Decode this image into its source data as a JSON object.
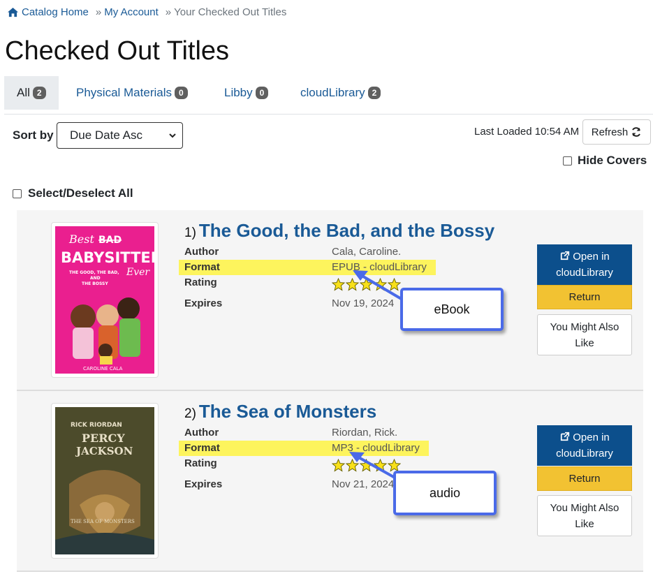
{
  "breadcrumb": {
    "home": "Catalog Home",
    "sep1": "»",
    "account": "My Account",
    "sep2": "»",
    "current": "Your Checked Out Titles"
  },
  "page_title": "Checked Out Titles",
  "tabs": [
    {
      "label": "All",
      "count": "2"
    },
    {
      "label": "Physical Materials",
      "count": "0"
    },
    {
      "label": "Libby",
      "count": "0"
    },
    {
      "label": "cloudLibrary",
      "count": "2"
    }
  ],
  "toolbar": {
    "sort_label": "Sort by",
    "sort_value": "Due Date Asc",
    "last_loaded": "Last Loaded 10:54 AM",
    "refresh_label": "Refresh",
    "hide_covers_label": "Hide Covers",
    "select_all_label": "Select/Deselect All"
  },
  "labels": {
    "author": "Author",
    "format": "Format",
    "rating": "Rating",
    "expires": "Expires"
  },
  "records": [
    {
      "number": "1)",
      "title": "The Good, the Bad, and the Bossy",
      "author": "Cala, Caroline.",
      "format": "EPUB - cloudLibrary",
      "rating": 5,
      "expires": "Nov 19, 2024",
      "open_label_line1": "Open in",
      "open_label_line2": "cloudLibrary",
      "return_label": "Return",
      "like_label": "You Might Also Like",
      "cover_text": {
        "line1": "Best",
        "line2": "BAD",
        "line3": "BABYSITTERS",
        "line4": "Ever",
        "line5": "THE GOOD, THE BAD,",
        "line6": "AND",
        "line7": "THE BOSSY",
        "line8": "CAROLINE CALA"
      },
      "cover_color": "#ea1f8f"
    },
    {
      "number": "2)",
      "title": "The Sea of Monsters",
      "author": "Riordan, Rick.",
      "format": "MP3 - cloudLibrary",
      "rating": 5,
      "expires": "Nov 21, 2024",
      "open_label_line1": "Open in",
      "open_label_line2": "cloudLibrary",
      "return_label": "Return",
      "like_label": "You Might Also Like",
      "cover_text": {
        "line1": "RICK RIORDAN",
        "line2": "PERCY",
        "line3": "JACKSON",
        "line4": "THE SEA OF MONSTERS"
      },
      "cover_color": "#5a4d2a"
    }
  ],
  "callouts": [
    {
      "label": "eBook"
    },
    {
      "label": "audio"
    }
  ],
  "colors": {
    "link": "#1a5a96",
    "primary_button": "#0c4f8c",
    "return_button": "#f2c232",
    "highlight": "#fdf45d",
    "callout_border": "#4a6ae8",
    "badge": "#5f5f5f"
  },
  "icons": [
    "home-icon",
    "chevron-down-icon",
    "refresh-icon",
    "external-link-icon",
    "star-icon"
  ]
}
